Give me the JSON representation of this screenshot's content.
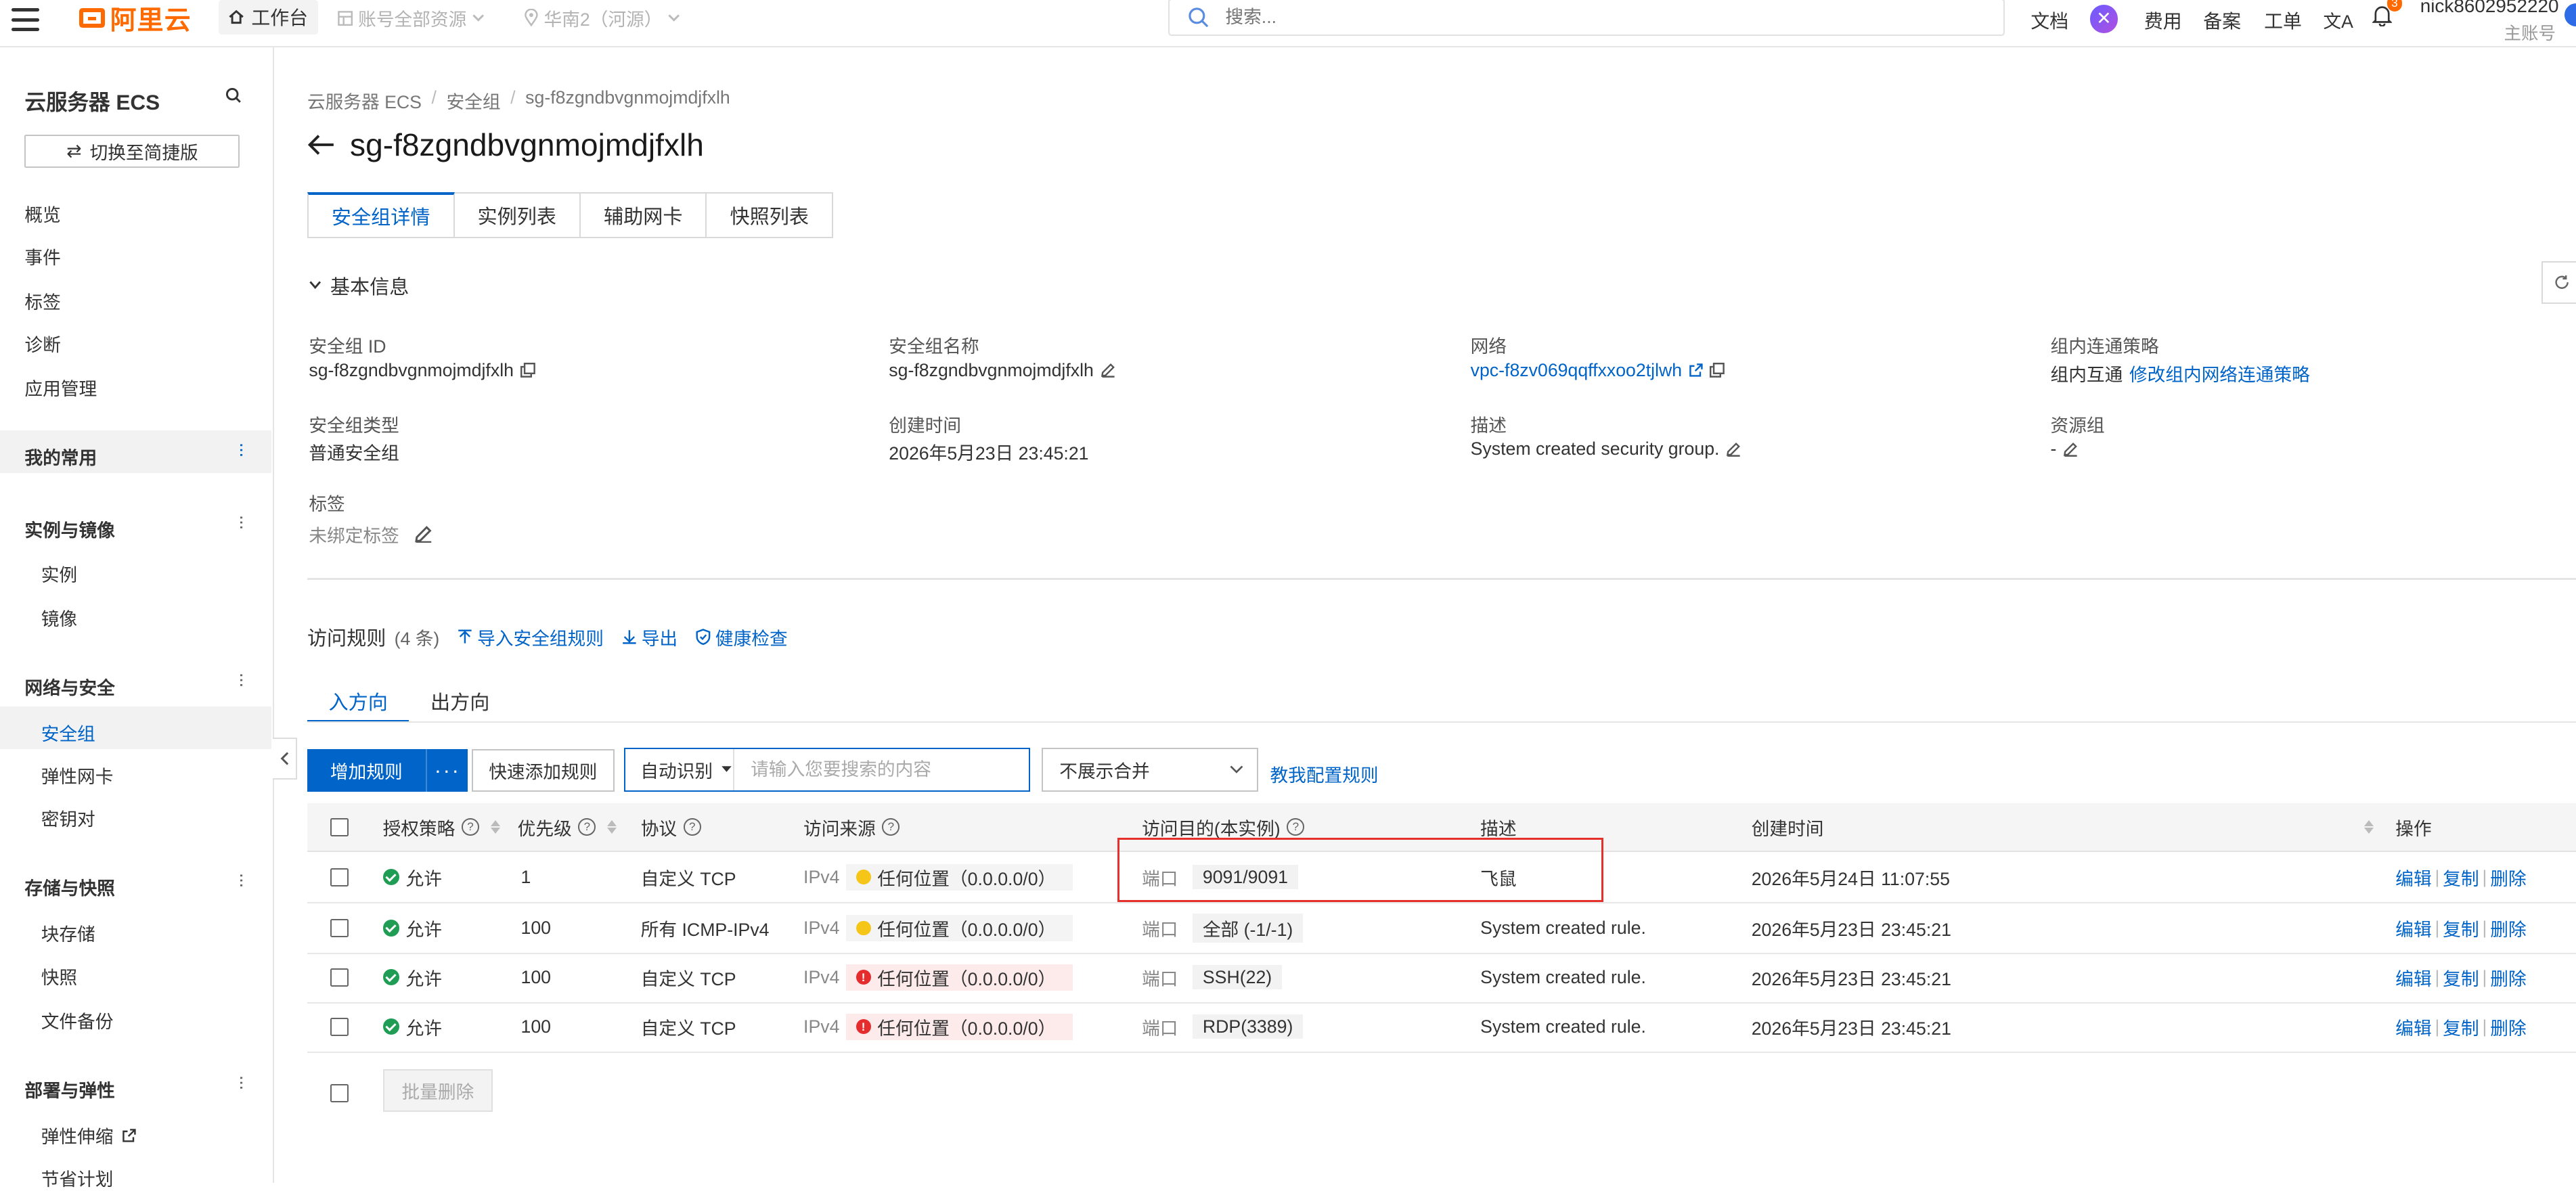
{
  "topbar": {
    "logo": "阿里云",
    "workbench": "工作台",
    "account_scope": "账号全部资源",
    "region": "华南2（河源）",
    "search_placeholder": "搜索...",
    "links": [
      "文档",
      "费用",
      "备案",
      "工单"
    ],
    "notification_count": "3",
    "user_name": "nick8602952220",
    "user_role": "主账号"
  },
  "sidebar": {
    "title": "云服务器 ECS",
    "switch_label": "切换至简捷版",
    "top_items": [
      "概览",
      "事件",
      "标签",
      "诊断",
      "应用管理"
    ],
    "favorites": "我的常用",
    "groups": {
      "instances": {
        "title": "实例与镜像",
        "items": [
          "实例",
          "镜像"
        ]
      },
      "network": {
        "title": "网络与安全",
        "items": [
          "安全组",
          "弹性网卡",
          "密钥对"
        ]
      },
      "storage": {
        "title": "存储与快照",
        "items": [
          "块存储",
          "快照",
          "文件备份"
        ]
      },
      "deploy": {
        "title": "部署与弹性",
        "items": [
          "弹性伸缩",
          "节省计划"
        ]
      }
    }
  },
  "breadcrumb": [
    "云服务器 ECS",
    "安全组",
    "sg-f8zgndbvgnmojmdjfxlh"
  ],
  "page_title": "sg-f8zgndbvgnmojmdjfxlh",
  "tabs": [
    "安全组详情",
    "实例列表",
    "辅助网卡",
    "快照列表"
  ],
  "basic_info": {
    "title": "基本信息",
    "sg_id_label": "安全组 ID",
    "sg_id": "sg-f8zgndbvgnmojmdjfxlh",
    "sg_name_label": "安全组名称",
    "sg_name": "sg-f8zgndbvgnmojmdjfxlh",
    "network_label": "网络",
    "network": "vpc-f8zv069qqffxxoo2tjlwh",
    "policy_label": "组内连通策略",
    "policy": "组内互通",
    "policy_link": "修改组内网络连通策略",
    "type_label": "安全组类型",
    "type": "普通安全组",
    "created_label": "创建时间",
    "created": "2026年5月23日 23:45:21",
    "desc_label": "描述",
    "desc": "System created security group.",
    "rg_label": "资源组",
    "rg": "-",
    "tags_label": "标签",
    "tags": "未绑定标签"
  },
  "rules": {
    "title": "访问规则",
    "count": "(4 条)",
    "import": "导入安全组规则",
    "export": "导出",
    "health": "健康检查",
    "direction_tabs": [
      "入方向",
      "出方向"
    ],
    "add_button": "增加规则",
    "more_button": "···",
    "quick_add": "快速添加规则",
    "search_type": "自动识别",
    "search_placeholder": "请输入您要搜索的内容",
    "merge_select": "不展示合并",
    "help_link": "教我配置规则",
    "columns": [
      "授权策略",
      "优先级",
      "协议",
      "访问来源",
      "访问目的(本实例)",
      "描述",
      "创建时间",
      "操作"
    ],
    "rows": [
      {
        "policy": "允许",
        "priority": "1",
        "protocol": "自定义 TCP",
        "ipver": "IPv4",
        "source": "任何位置（0.0.0.0/0）",
        "risk": "warn",
        "port_label": "端口",
        "port": "9091/9091",
        "desc": "飞鼠",
        "created": "2026年5月24日 11:07:55"
      },
      {
        "policy": "允许",
        "priority": "100",
        "protocol": "所有 ICMP-IPv4",
        "ipver": "IPv4",
        "source": "任何位置（0.0.0.0/0）",
        "risk": "warn",
        "port_label": "端口",
        "port": "全部 (-1/-1)",
        "desc": "System created rule.",
        "created": "2026年5月23日 23:45:21"
      },
      {
        "policy": "允许",
        "priority": "100",
        "protocol": "自定义 TCP",
        "ipver": "IPv4",
        "source": "任何位置（0.0.0.0/0）",
        "risk": "danger",
        "port_label": "端口",
        "port": "SSH(22)",
        "desc": "System created rule.",
        "created": "2026年5月23日 23:45:21"
      },
      {
        "policy": "允许",
        "priority": "100",
        "protocol": "自定义 TCP",
        "ipver": "IPv4",
        "source": "任何位置（0.0.0.0/0）",
        "risk": "danger",
        "port_label": "端口",
        "port": "RDP(3389)",
        "desc": "System created rule.",
        "created": "2026年5月23日 23:45:21"
      }
    ],
    "actions": [
      "编辑",
      "复制",
      "删除"
    ],
    "batch_delete": "批量删除"
  },
  "colors": {
    "primary": "#0064c8",
    "brand": "#ff6a00",
    "allow": "#1f9d55",
    "danger": "#e52d2d",
    "warn": "#f5c518",
    "highlight_box": "#e5302b"
  }
}
